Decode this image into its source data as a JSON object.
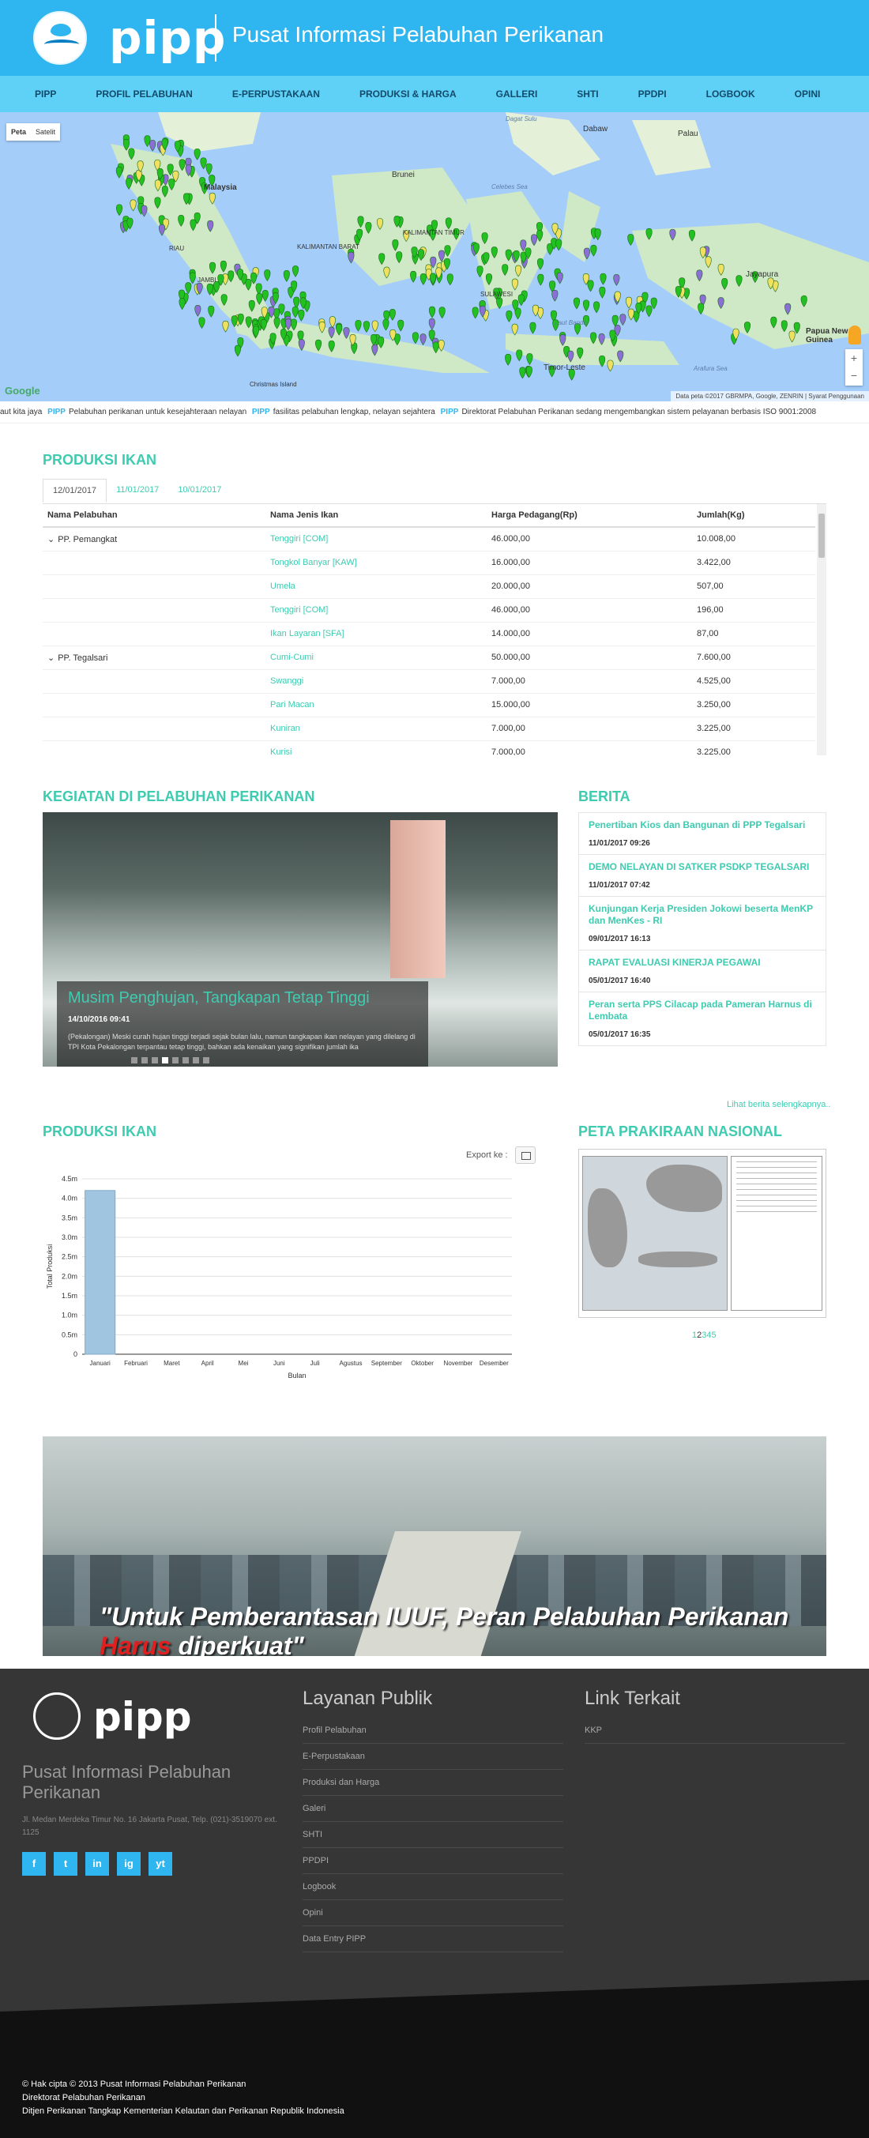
{
  "header": {
    "logo_text": "pipp",
    "title": "Pusat Informasi Pelabuhan Perikanan"
  },
  "nav": [
    "PIPP",
    "PROFIL PELABUHAN",
    "E-PERPUSTAKAAN",
    "PRODUKSI & HARGA",
    "GALLERI",
    "SHTI",
    "PPDPI",
    "LOGBOOK",
    "OPINI"
  ],
  "map": {
    "toggle": [
      "Peta",
      "Satelit"
    ],
    "labels": [
      "Malaysia",
      "Brunei",
      "Dagat Sulu",
      "Dabaw",
      "Palau",
      "Celebes Sea",
      "Jayapura",
      "Papua New Guinea",
      "Christmas Island",
      "Timor-Leste",
      "Laut Banda",
      "Arafura Sea",
      "KALIMANTAN BARAT",
      "KALIMANTAN TIMUR",
      "SULAWESI",
      "RIAU",
      "JAMBI"
    ],
    "attribution": "Data peta ©2017 GBRMPA, Google, ZENRIN",
    "terms": "Syarat Penggunaan",
    "google": "Google",
    "zoom_in": "+",
    "zoom_out": "−"
  },
  "ticker": {
    "segments": [
      {
        "brand": "",
        "text": "aut kita jaya"
      },
      {
        "brand": "PIPP",
        "text": "Pelabuhan perikanan untuk kesejahteraan nelayan"
      },
      {
        "brand": "PIPP",
        "text": "fasilitas pelabuhan lengkap, nelayan sejahtera"
      },
      {
        "brand": "PIPP",
        "text": "Direktorat Pelabuhan Perikanan sedang mengembangkan sistem pelayanan berbasis ISO 9001:2008"
      }
    ]
  },
  "produksi": {
    "title": "PRODUKSI IKAN",
    "tabs": [
      "12/01/2017",
      "11/01/2017",
      "10/01/2017"
    ],
    "columns": [
      "Nama Pelabuhan",
      "Nama Jenis Ikan",
      "Harga Pedagang(Rp)",
      "Jumlah(Kg)"
    ],
    "rows": [
      [
        "PP. Pemangkat",
        "Tenggiri [COM]",
        "46.000,00",
        "10.008,00"
      ],
      [
        "",
        "Tongkol Banyar [KAW]",
        "16.000,00",
        "3.422,00"
      ],
      [
        "",
        "Umela",
        "20.000,00",
        "507,00"
      ],
      [
        "",
        "Tenggiri [COM]",
        "46.000,00",
        "196,00"
      ],
      [
        "",
        "Ikan Layaran [SFA]",
        "14.000,00",
        "87,00"
      ],
      [
        "PP. Tegalsari",
        "Cumi-Cumi",
        "50.000,00",
        "7.600,00"
      ],
      [
        "",
        "Swanggi",
        "7.000,00",
        "4.525,00"
      ],
      [
        "",
        "Pari Macan",
        "15.000,00",
        "3.250,00"
      ],
      [
        "",
        "Kuniran",
        "7.000,00",
        "3.225,00"
      ],
      [
        "",
        "Kurisi",
        "7.000,00",
        "3.225,00"
      ]
    ]
  },
  "kegiatan": {
    "title": "KEGIATAN DI PELABUHAN PERIKANAN",
    "slide_title": "Musim Penghujan, Tangkapan Tetap Tinggi",
    "slide_date": "14/10/2016 09:41",
    "slide_excerpt": "(Pekalongan) Meski curah hujan tinggi terjadi sejak bulan lalu, namun tangkapan ikan nelayan yang dilelang di TPI Kota Pekalongan terpantau tetap tinggi, bahkan ada kenaikan yang signifikan jumlah ika",
    "dot_count": 8,
    "active_dot": 3
  },
  "berita": {
    "title": "BERITA",
    "items": [
      {
        "title": "Penertiban Kios dan Bangunan di PPP Tegalsari",
        "date": "11/01/2017 09:26"
      },
      {
        "title": "DEMO NELAYAN DI SATKER PSDKP TEGALSARI",
        "date": "11/01/2017 07:42"
      },
      {
        "title": "Kunjungan Kerja Presiden Jokowi beserta MenKP dan MenKes - RI",
        "date": "09/01/2017 16:13"
      },
      {
        "title": "RAPAT EVALUASI KINERJA PEGAWAI",
        "date": "05/01/2017 16:40"
      },
      {
        "title": "Peran serta PPS Cilacap pada Pameran Harnus di Lembata",
        "date": "05/01/2017 16:35"
      }
    ],
    "more": "Lihat berita selengkapnya.."
  },
  "chart_section": {
    "title": "PRODUKSI IKAN",
    "export_label": "Export ke :"
  },
  "chart_data": {
    "type": "bar",
    "categories": [
      "Januari",
      "Februari",
      "Maret",
      "April",
      "Mei",
      "Juni",
      "Juli",
      "Agustus",
      "September",
      "Oktober",
      "November",
      "Desember"
    ],
    "values": [
      4200000,
      0,
      0,
      0,
      0,
      0,
      0,
      0,
      0,
      0,
      0,
      0
    ],
    "xlabel": "Bulan",
    "ylabel": "Total Produksi",
    "ylim": [
      0,
      4500000
    ],
    "yticks": [
      "0",
      "0.5m",
      "1.0m",
      "1.5m",
      "2.0m",
      "2.5m",
      "3.0m",
      "3.5m",
      "4.0m",
      "4.5m"
    ],
    "grid": true,
    "color": "#9fc5e0"
  },
  "prakiraan": {
    "title": "PETA PRAKIRAAN NASIONAL",
    "pages": [
      "1",
      "2",
      "3",
      "4",
      "5"
    ],
    "current_page": "2"
  },
  "banner": {
    "text_before": "\"Untuk Pemberantasan IUUF, Peran Pelabuhan Perikanan",
    "text_red": "Harus",
    "text_after": "diperkuat\""
  },
  "footer": {
    "logo_text": "pipp",
    "org": "Pusat Informasi Pelabuhan Perikanan",
    "address": "Jl. Medan Merdeka Timur No. 16 Jakarta Pusat, Telp. (021)-3519070 ext. 1125",
    "socials": [
      "f",
      "t",
      "in",
      "ig",
      "yt"
    ],
    "layanan_title": "Layanan Publik",
    "layanan": [
      "Profil Pelabuhan",
      "E-Perpustakaan",
      "Produksi dan Harga",
      "Galeri",
      "SHTI",
      "PPDPI",
      "Logbook",
      "Opini",
      "Data Entry PIPP"
    ],
    "link_title": "Link Terkait",
    "links": [
      "KKP"
    ],
    "copyright": [
      "© Hak cipta © 2013 Pusat Informasi Pelabuhan Perikanan",
      "Direktorat Pelabuhan Perikanan",
      "Ditjen Perikanan Tangkap Kementerian Kelautan dan Perikanan Republik Indonesia"
    ]
  }
}
